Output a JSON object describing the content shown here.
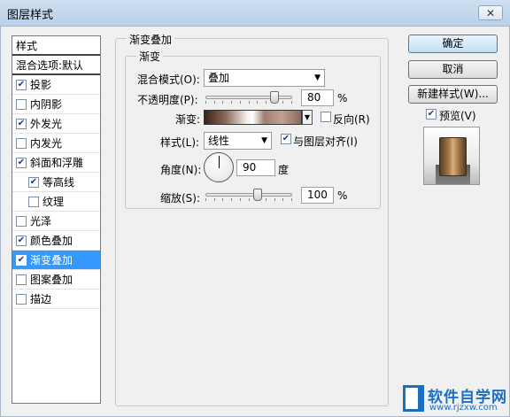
{
  "window": {
    "title": "图层样式",
    "close_glyph": "✕"
  },
  "sidebar": {
    "header": "样式",
    "blend_options": "混合选项:默认",
    "items": [
      {
        "label": "投影",
        "checked": true,
        "sub": false,
        "selected": false
      },
      {
        "label": "内阴影",
        "checked": false,
        "sub": false,
        "selected": false
      },
      {
        "label": "外发光",
        "checked": true,
        "sub": false,
        "selected": false
      },
      {
        "label": "内发光",
        "checked": false,
        "sub": false,
        "selected": false
      },
      {
        "label": "斜面和浮雕",
        "checked": true,
        "sub": false,
        "selected": false
      },
      {
        "label": "等高线",
        "checked": true,
        "sub": true,
        "selected": false
      },
      {
        "label": "纹理",
        "checked": false,
        "sub": true,
        "selected": false
      },
      {
        "label": "光泽",
        "checked": false,
        "sub": false,
        "selected": false
      },
      {
        "label": "颜色叠加",
        "checked": true,
        "sub": false,
        "selected": false
      },
      {
        "label": "渐变叠加",
        "checked": true,
        "sub": false,
        "selected": true
      },
      {
        "label": "图案叠加",
        "checked": false,
        "sub": false,
        "selected": false
      },
      {
        "label": "描边",
        "checked": false,
        "sub": false,
        "selected": false
      }
    ]
  },
  "panel": {
    "title": "渐变叠加",
    "section": "渐变",
    "blend_mode_label": "混合模式(O):",
    "blend_mode_value": "叠加",
    "opacity_label": "不透明度(P):",
    "opacity_value": "80",
    "opacity_unit": "%",
    "opacity_fraction": 0.8,
    "gradient_label": "渐变:",
    "reverse_label": "反向(R)",
    "reverse_checked": false,
    "style_label": "样式(L):",
    "style_value": "线性",
    "align_label": "与图层对齐(I)",
    "align_checked": true,
    "angle_label": "角度(N):",
    "angle_value": "90",
    "angle_unit": "度",
    "scale_label": "缩放(S):",
    "scale_value": "100",
    "scale_unit": "%",
    "scale_fraction": 0.6
  },
  "buttons": {
    "ok": "确定",
    "cancel": "取消",
    "new_style": "新建样式(W)...",
    "preview_label": "预览(V)",
    "preview_checked": true
  },
  "watermark": {
    "main": "软件自学网",
    "sub": "www.rjzxw.com"
  }
}
